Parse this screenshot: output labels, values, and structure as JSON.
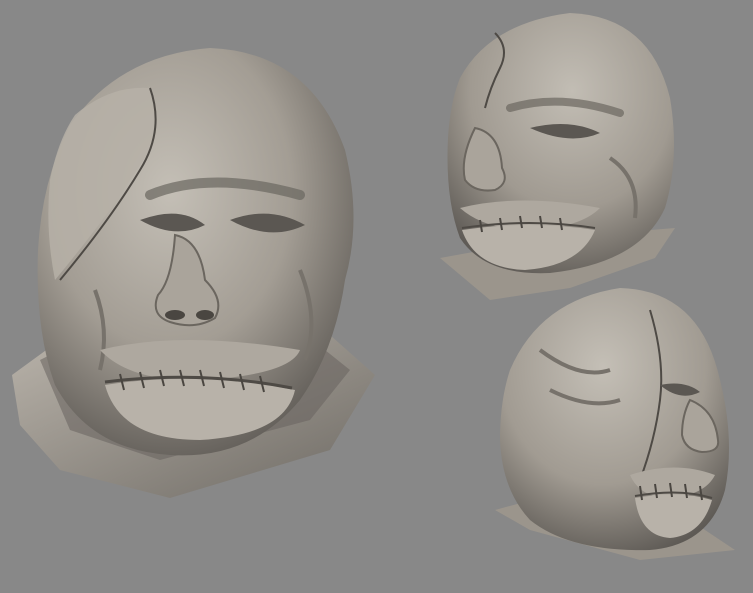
{
  "scene": {
    "background_color": "#888888",
    "material_color": "#a8a39b",
    "views": [
      {
        "id": "front",
        "subject": "sculpted-head",
        "stitches": 8
      },
      {
        "id": "three-quarter",
        "subject": "sculpted-head",
        "stitches": 5
      },
      {
        "id": "profile",
        "subject": "sculpted-head",
        "stitches": 5
      }
    ]
  }
}
